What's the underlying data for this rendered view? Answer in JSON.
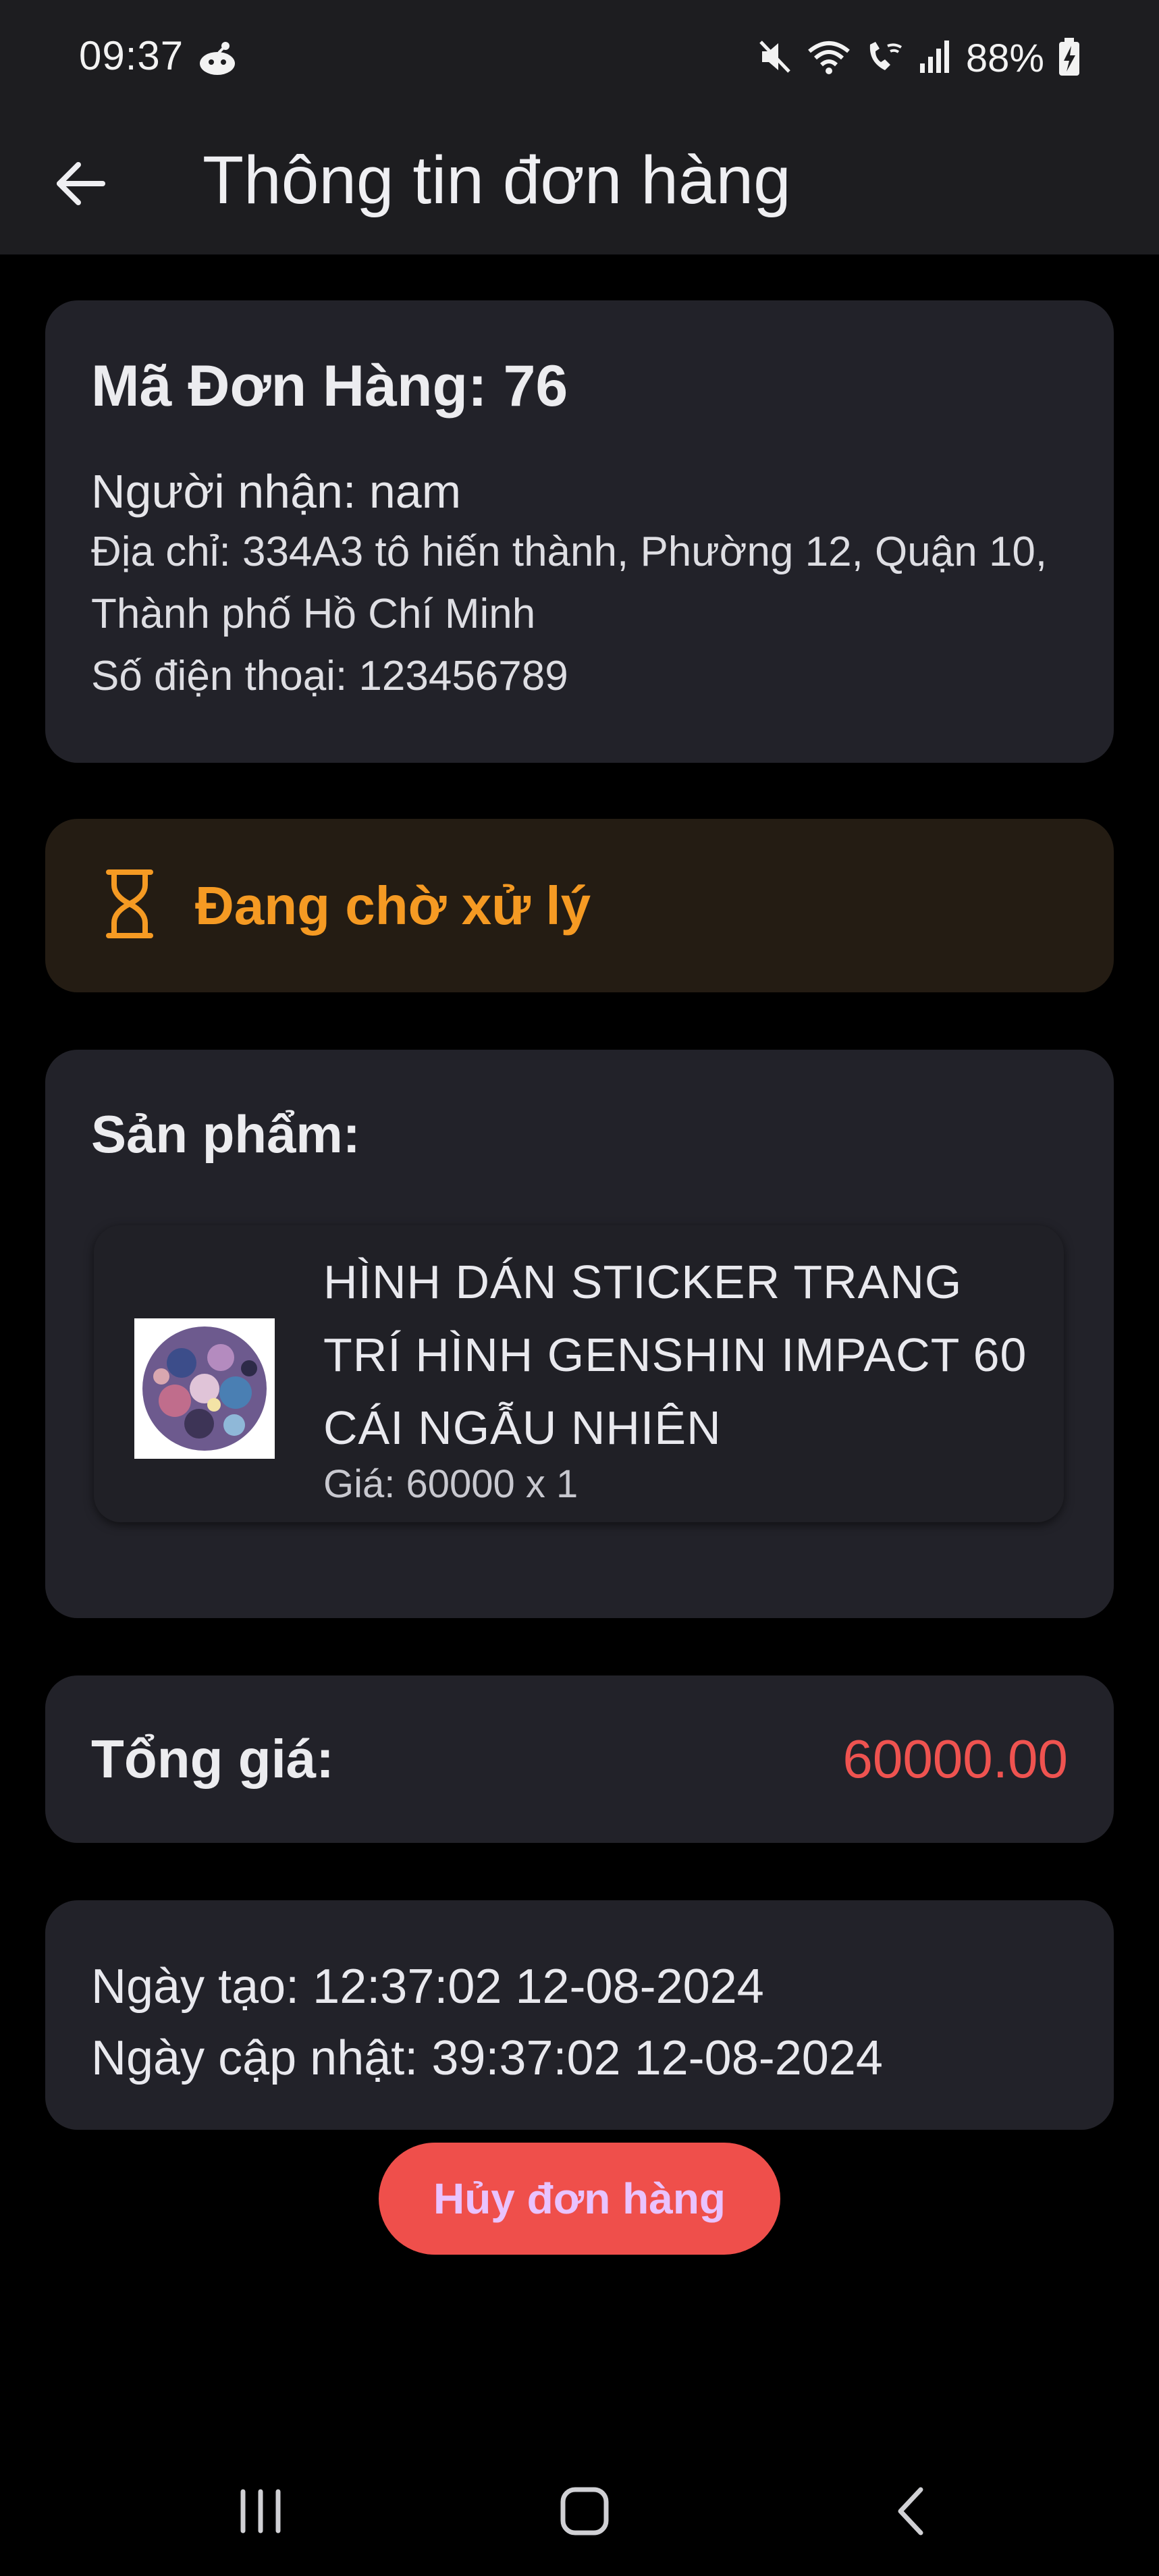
{
  "status_bar": {
    "time": "09:37",
    "battery": "88%",
    "icons": [
      "mute-icon",
      "wifi-icon",
      "wifi-call-icon",
      "signal-icon",
      "battery-charging-icon"
    ]
  },
  "app_bar": {
    "title": "Thông tin đơn hàng",
    "back_icon": "arrow-left-icon"
  },
  "order": {
    "id_label": "Mã Đơn Hàng: 76",
    "recipient": "Người nhận: nam",
    "address": "Địa chỉ: 334A3 tô hiến thành, Phường 12, Quận 10, Thành phố Hồ Chí Minh",
    "phone": "Số điện thoại: 123456789"
  },
  "status": {
    "icon": "hourglass-icon",
    "text": "Đang chờ xử lý",
    "color": "#f59a23"
  },
  "products": {
    "title": "Sản phẩm:",
    "items": [
      {
        "name": "HÌNH DÁN STICKER TRANG TRÍ HÌNH GENSHIN IMPACT 60 CÁI NGẪU NHIÊN",
        "price_line": "Giá: 60000 x 1"
      }
    ]
  },
  "total": {
    "label": "Tổng giá:",
    "value": "60000.00",
    "value_color": "#ef5350"
  },
  "dates": {
    "created": "Ngày tạo: 12:37:02 12-08-2024",
    "updated": "Ngày cập nhật: 39:37:02 12-08-2024"
  },
  "actions": {
    "cancel_label": "Hủy đơn hàng",
    "cancel_color": "#ef4f4b"
  },
  "nav_bar": {
    "icons": [
      "recent-apps-icon",
      "home-icon",
      "back-icon"
    ]
  }
}
